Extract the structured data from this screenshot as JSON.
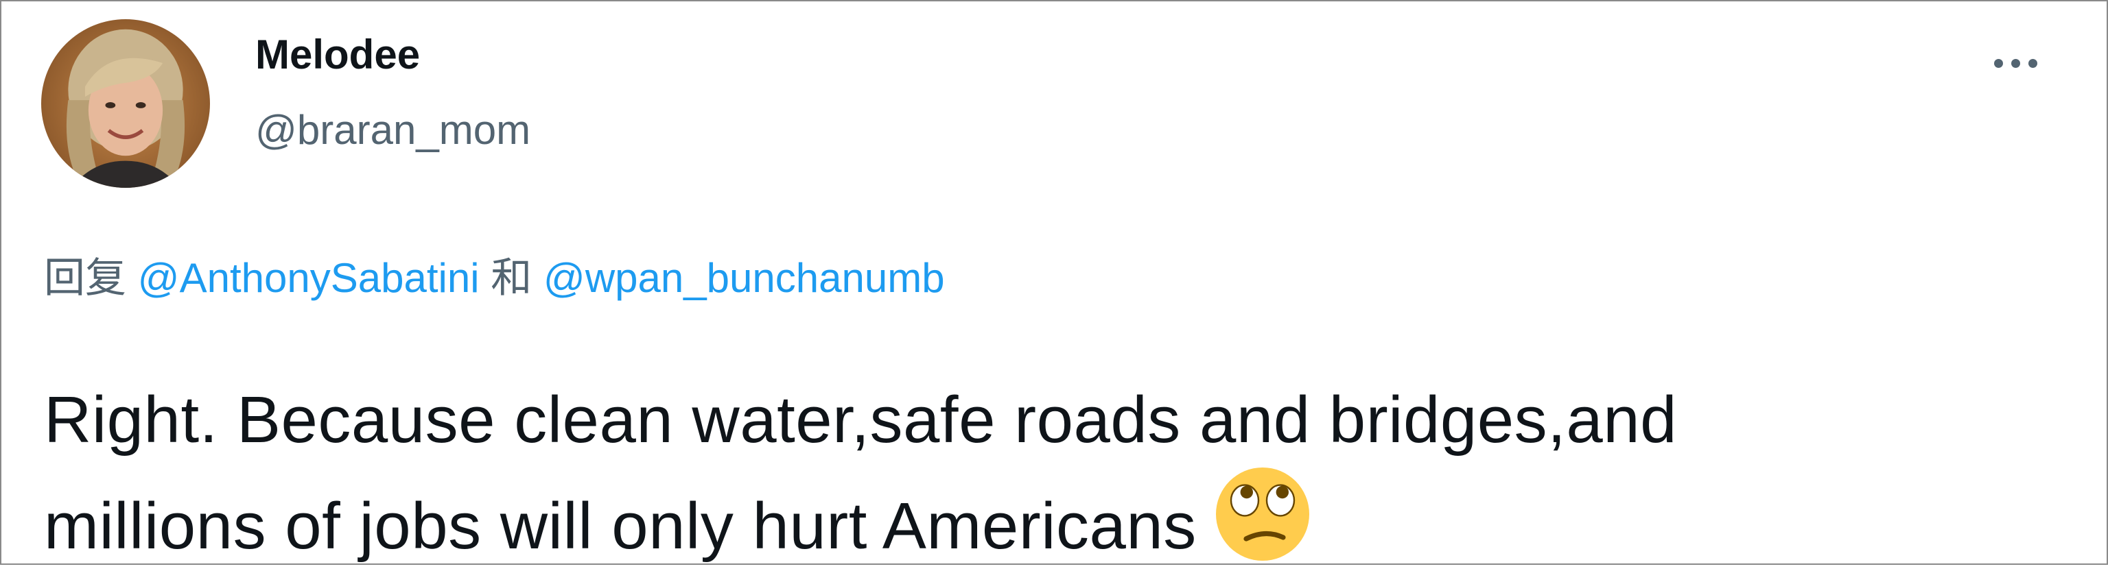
{
  "author": {
    "display_name": "Melodee",
    "handle": "@braran_mom"
  },
  "menu": {
    "icon": "more-horizontal-icon"
  },
  "reply": {
    "prefix": "回复",
    "mention_1": "@AnthonySabatini",
    "conjunction": "和",
    "mention_2": "@wpan_bunchanumb"
  },
  "tweet": {
    "line_1": "Right. Because clean water,safe roads and bridges,and",
    "line_2": "millions of jobs will only hurt Americans",
    "emoji": "face-with-rolling-eyes-icon"
  },
  "colors": {
    "text": "#0f1419",
    "secondary": "#536471",
    "link": "#1d9bf0",
    "border": "#8a8a8a",
    "emoji_yellow": "#ffcc4d"
  }
}
